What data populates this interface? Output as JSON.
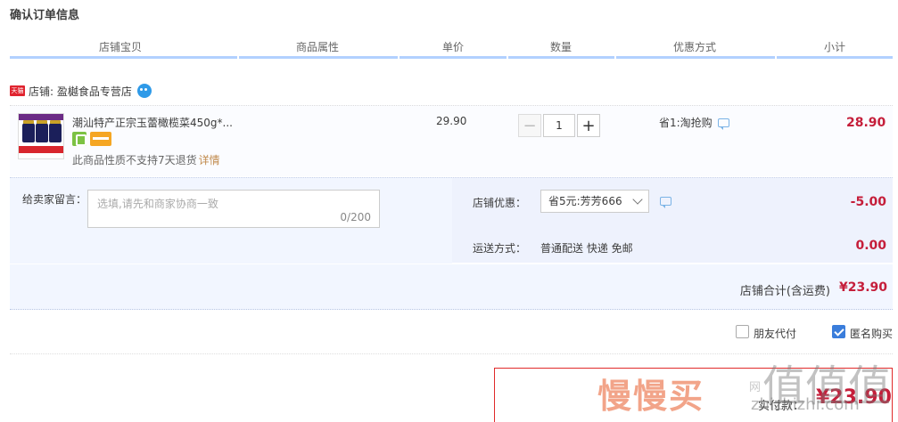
{
  "page": {
    "title": "确认订单信息"
  },
  "header": {
    "columns": [
      "店铺宝贝",
      "商品属性",
      "单价",
      "数量",
      "优惠方式",
      "小计"
    ]
  },
  "shop": {
    "badge": "天猫",
    "label": "店铺: 盈樾食品专营店"
  },
  "item": {
    "title": "潮汕特产正宗玉蕾橄榄菜450g*...",
    "return_note": "此商品性质不支持7天退货",
    "detail_link": "详情",
    "unit_price": "29.90",
    "quantity": "1",
    "minus": "−",
    "plus": "+",
    "promo": "省1:淘抢购",
    "subtotal": "28.90"
  },
  "memo": {
    "label": "给卖家留言：",
    "placeholder": "选填,请先和商家协商一致",
    "count": "0/200"
  },
  "shop_discount": {
    "label": "店铺优惠：",
    "selected": "省5元:芳芳666",
    "amount": "-5.00"
  },
  "shipping": {
    "label": "运送方式：",
    "value": "普通配送 快递 免邮",
    "amount": "0.00"
  },
  "shop_total": {
    "label": "店铺合计(含运费)",
    "amount": "¥23.90"
  },
  "options": {
    "friend_pay": {
      "label": "朋友代付",
      "checked": false
    },
    "anonymous": {
      "label": "匿名购买",
      "checked": true
    }
  },
  "payment": {
    "label": "实付款：",
    "amount": "¥23.90"
  },
  "watermark": {
    "brand": "慢慢买",
    "sub": "网",
    "right": "值值值",
    "url": "zhizhizhi.com"
  },
  "colors": {
    "price_red": "#c51e3a",
    "accent_blue": "#b2d1ff",
    "checkbox_blue": "#3a7ddb",
    "tmall_red": "#e0242f"
  },
  "icons": [
    "tmall-badge-icon",
    "wangwang-icon",
    "service-icon",
    "card-icon",
    "chat-icon",
    "chevron-down-icon",
    "checkmark-icon"
  ]
}
